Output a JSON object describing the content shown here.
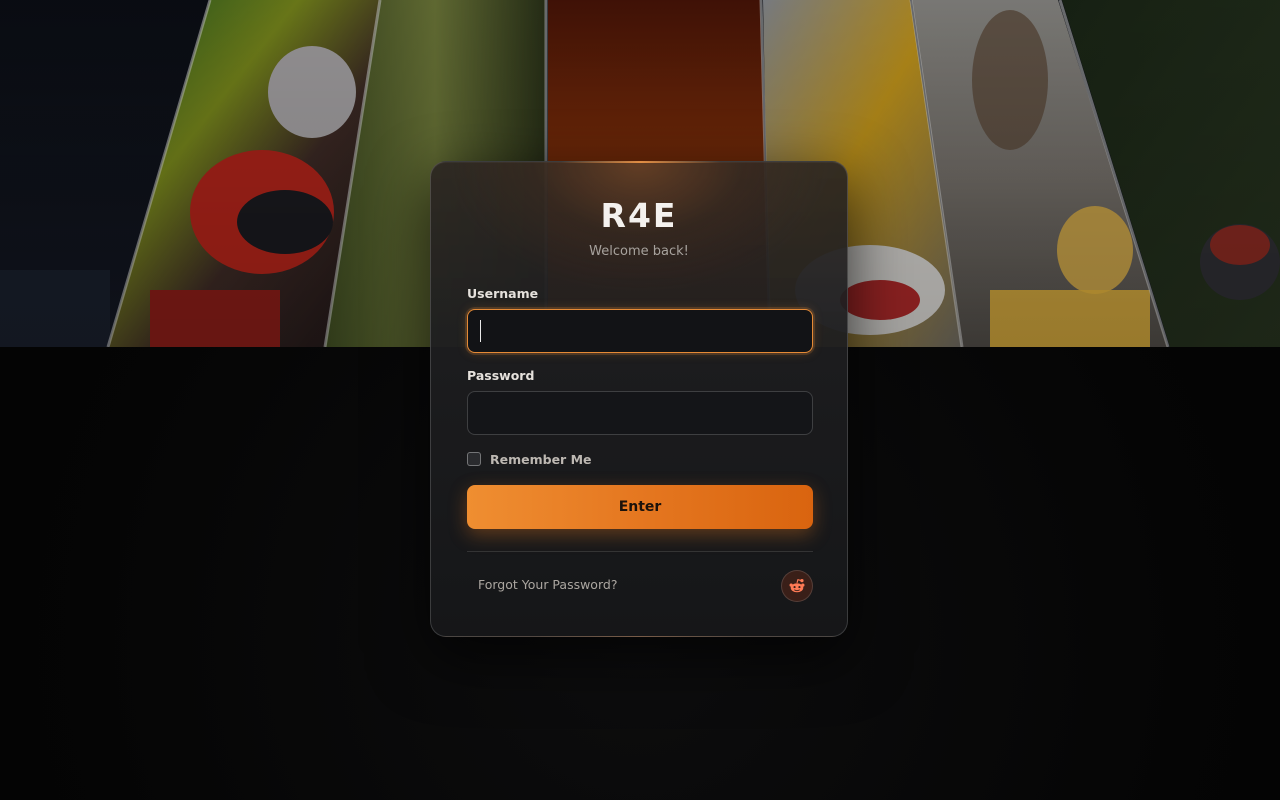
{
  "brand": {
    "title": "R4E",
    "subtitle": "Welcome back!"
  },
  "form": {
    "username_label": "Username",
    "username_value": "",
    "password_label": "Password",
    "password_value": "",
    "remember_label": "Remember Me",
    "remember_checked": false,
    "submit_label": "Enter"
  },
  "footer": {
    "forgot_label": "Forgot Your Password?",
    "social_icon": "reddit-icon"
  },
  "colors": {
    "accent": "#E57720",
    "card_bg": "#1E1F22",
    "page_bg": "#050505"
  }
}
